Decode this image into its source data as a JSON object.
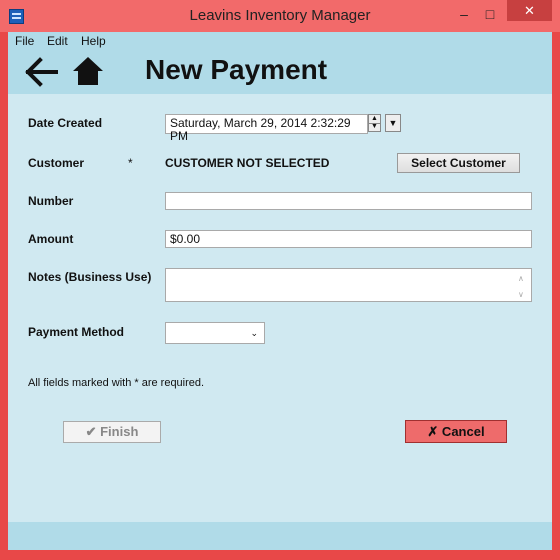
{
  "window": {
    "title": "Leavins Inventory Manager",
    "minimize": "–",
    "maximize": "□",
    "close": "✕"
  },
  "menu": {
    "file": "File",
    "edit": "Edit",
    "help": "Help"
  },
  "header": {
    "title": "New Payment",
    "back_icon": "arrow-left-icon",
    "home_icon": "home-icon"
  },
  "form": {
    "date_created": {
      "label": "Date Created",
      "value": "Saturday, March 29, 2014 2:32:29 PM"
    },
    "customer": {
      "label": "Customer",
      "required_marker": "*",
      "value": "CUSTOMER NOT SELECTED",
      "button": "Select Customer"
    },
    "number": {
      "label": "Number",
      "value": ""
    },
    "amount": {
      "label": "Amount",
      "value": "$0.00"
    },
    "notes": {
      "label": "Notes (Business Use)",
      "value": ""
    },
    "payment_method": {
      "label": "Payment Method",
      "value": ""
    },
    "required_note": "All fields marked with * are required."
  },
  "actions": {
    "finish": "✔ Finish",
    "cancel": "✗ Cancel"
  },
  "colors": {
    "frame": "#e84848",
    "background": "#d0e9f1",
    "header": "#b0dbe8",
    "cancel": "#ee6b6b"
  }
}
